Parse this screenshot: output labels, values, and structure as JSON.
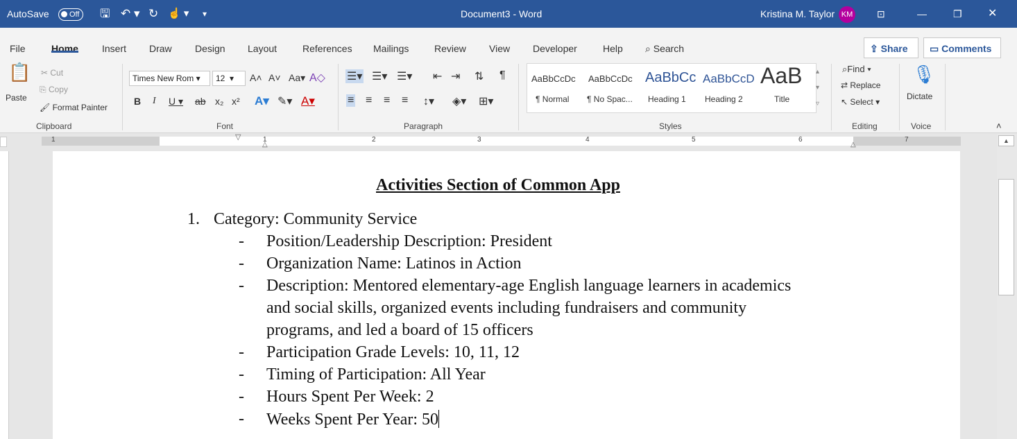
{
  "titlebar": {
    "autosave_label": "AutoSave",
    "autosave_state": "Off",
    "doc_title": "Document3 - Word",
    "user_name": "Kristina M. Taylor",
    "user_initials": "KM"
  },
  "tabs": [
    "File",
    "Home",
    "Insert",
    "Draw",
    "Design",
    "Layout",
    "References",
    "Mailings",
    "Review",
    "View",
    "Developer",
    "Help"
  ],
  "search_label": "Search",
  "share_label": "Share",
  "comments_label": "Comments",
  "clipboard": {
    "paste": "Paste",
    "cut": "Cut",
    "copy": "Copy",
    "format_painter": "Format Painter",
    "group": "Clipboard"
  },
  "font": {
    "name": "Times New Rom",
    "size": "12",
    "group": "Font",
    "case": "Aa"
  },
  "paragraph": {
    "group": "Paragraph"
  },
  "styles": {
    "group": "Styles",
    "items": [
      {
        "preview": "AaBbCcDc",
        "label": "¶ Normal"
      },
      {
        "preview": "AaBbCcDc",
        "label": "¶ No Spac..."
      },
      {
        "preview": "AaBbCc",
        "label": "Heading 1"
      },
      {
        "preview": "AaBbCcD",
        "label": "Heading 2"
      },
      {
        "preview": "AaB",
        "label": "Title"
      }
    ]
  },
  "editing": {
    "find": "Find",
    "replace": "Replace",
    "select": "Select",
    "group": "Editing"
  },
  "voice": {
    "dictate": "Dictate",
    "group": "Voice"
  },
  "ruler_numbers": [
    "1",
    "1",
    "2",
    "3",
    "4",
    "5",
    "6",
    "7"
  ],
  "document": {
    "title": "Activities Section of Common App",
    "list_number": "1.",
    "category": "Category: Community Service",
    "bullets": [
      "Position/Leadership Description: President",
      "Organization Name: Latinos in Action",
      "Description: Mentored elementary-age English language learners in academics",
      "and social skills, organized events including fundraisers and community",
      "programs, and led a board of 15 officers",
      "Participation Grade Levels: 10, 11, 12",
      "Timing of Participation: All Year",
      "Hours Spent Per Week: 2",
      "Weeks Spent Per Year: 50"
    ]
  },
  "colors": {
    "word_blue": "#2b579a",
    "avatar": "#b4009e"
  }
}
